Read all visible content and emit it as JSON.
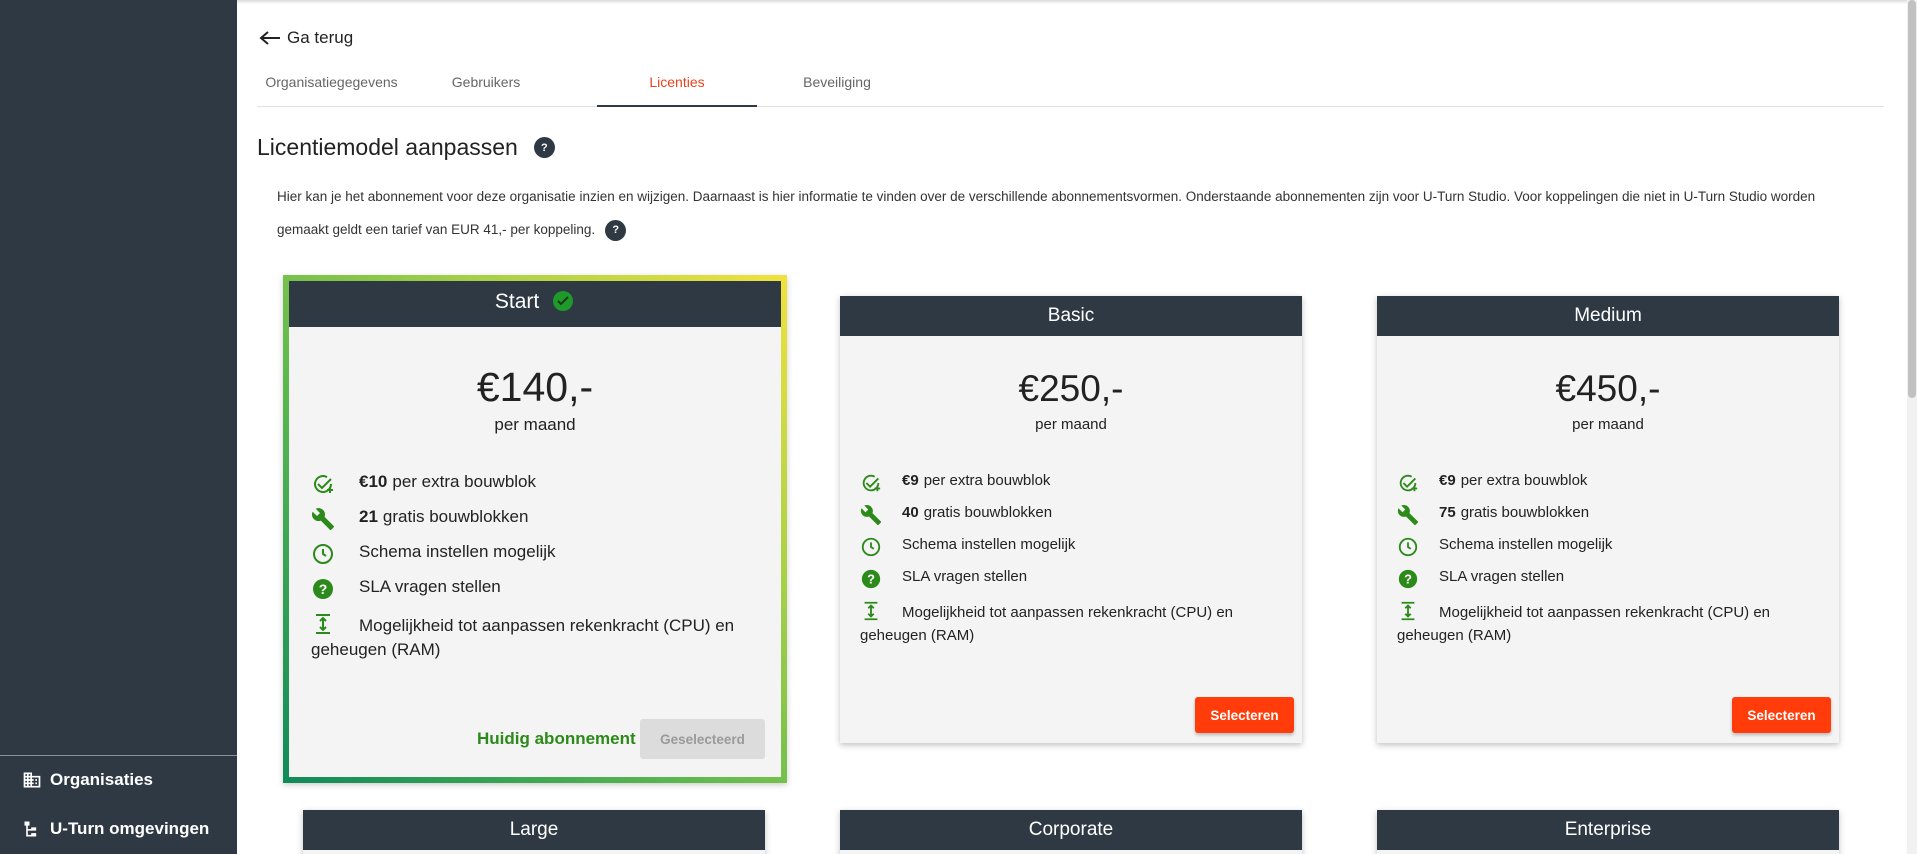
{
  "sidebar": {
    "items": [
      {
        "label": "Organisaties",
        "icon": "building-icon"
      },
      {
        "label": "U-Turn omgevingen",
        "icon": "hierarchy-icon"
      }
    ]
  },
  "header": {
    "back_label": "Ga terug",
    "tabs": [
      {
        "label": "Organisatiegegevens",
        "active": false
      },
      {
        "label": "Gebruikers",
        "active": false
      },
      {
        "label": "Licenties",
        "active": true
      },
      {
        "label": "Beveiliging",
        "active": false
      }
    ]
  },
  "main": {
    "title": "Licentiemodel aanpassen",
    "help_glyph": "?",
    "description_line1": "Hier kan je het abonnement voor deze organisatie inzien en wijzigen. Daarnaast is hier informatie te vinden over de verschillende abonnementsvormen. Onderstaande abonnementen zijn voor U-Turn Studio. Voor koppelingen die niet in U-Turn Studio worden",
    "description_line2": "gemaakt geldt een tarief van EUR 41,- per koppeling."
  },
  "plans": {
    "start": {
      "name": "Start",
      "price": "€140,-",
      "period": "per maand",
      "features": [
        {
          "bold": "€10",
          "text": "per extra bouwblok",
          "icon": "check-plus-icon"
        },
        {
          "bold": "21",
          "text": "gratis bouwblokken",
          "icon": "wrench-icon"
        },
        {
          "bold": "",
          "text": "Schema instellen mogelijk",
          "icon": "clock-icon"
        },
        {
          "bold": "",
          "text": "SLA vragen stellen",
          "icon": "question-circle-icon"
        },
        {
          "bold": "",
          "text": "Mogelijkheid tot aanpassen rekenkracht (CPU) en geheugen (RAM)",
          "icon": "expand-vertical-icon"
        }
      ],
      "current_label": "Huidig abonnement",
      "button_label": "Geselecteerd",
      "selected": true
    },
    "basic": {
      "name": "Basic",
      "price": "€250,-",
      "period": "per maand",
      "features": [
        {
          "bold": "€9",
          "text": "per extra bouwblok",
          "icon": "check-plus-icon"
        },
        {
          "bold": "40",
          "text": "gratis bouwblokken",
          "icon": "wrench-icon"
        },
        {
          "bold": "",
          "text": "Schema instellen mogelijk",
          "icon": "clock-icon"
        },
        {
          "bold": "",
          "text": "SLA vragen stellen",
          "icon": "question-circle-icon"
        },
        {
          "bold": "",
          "text": "Mogelijkheid tot aanpassen rekenkracht (CPU) en geheugen (RAM)",
          "icon": "expand-vertical-icon"
        }
      ],
      "button_label": "Selecteren"
    },
    "medium": {
      "name": "Medium",
      "price": "€450,-",
      "period": "per maand",
      "features": [
        {
          "bold": "€9",
          "text": "per extra bouwblok",
          "icon": "check-plus-icon"
        },
        {
          "bold": "75",
          "text": "gratis bouwblokken",
          "icon": "wrench-icon"
        },
        {
          "bold": "",
          "text": "Schema instellen mogelijk",
          "icon": "clock-icon"
        },
        {
          "bold": "",
          "text": "SLA vragen stellen",
          "icon": "question-circle-icon"
        },
        {
          "bold": "",
          "text": "Mogelijkheid tot aanpassen rekenkracht (CPU) en geheugen (RAM)",
          "icon": "expand-vertical-icon"
        }
      ],
      "button_label": "Selecteren"
    },
    "large": {
      "name": "Large"
    },
    "corporate": {
      "name": "Corporate"
    },
    "enterprise": {
      "name": "Enterprise"
    }
  },
  "colors": {
    "sidebar_bg": "#2f3944",
    "accent": "#e8431c",
    "select_button": "#ff3c0a",
    "icon_green": "#2c8a1a"
  }
}
